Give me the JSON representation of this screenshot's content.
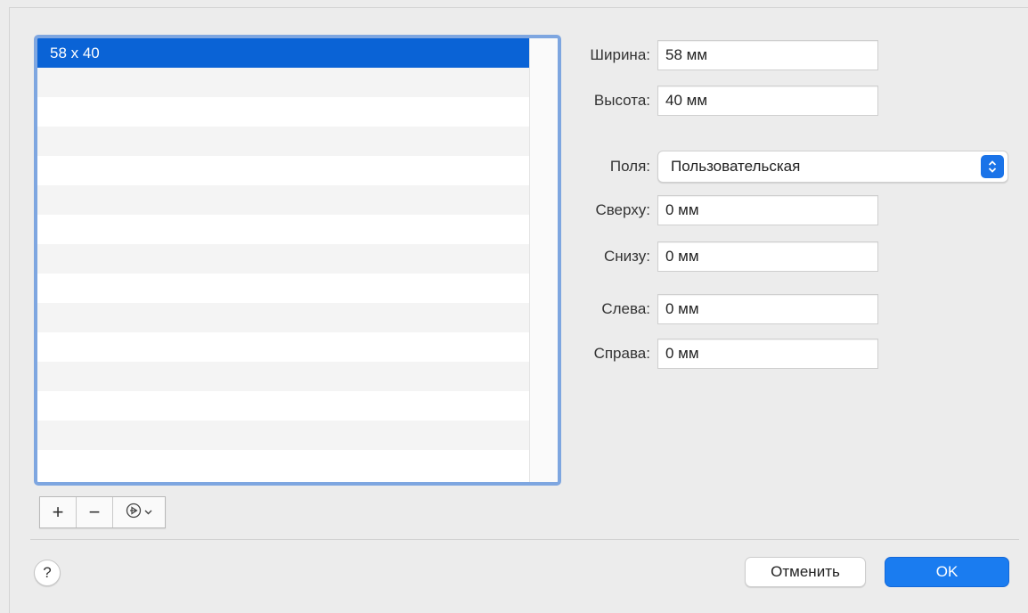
{
  "list": {
    "items": [
      "58 x 40"
    ],
    "empty_rows": 14
  },
  "toolbar": {
    "add_label": "+",
    "remove_label": "−",
    "action_icon": "action-menu-icon"
  },
  "form": {
    "width_label": "Ширина:",
    "width_value": "58 мм",
    "height_label": "Высота:",
    "height_value": "40 мм",
    "margins_label": "Поля:",
    "margins_selected": "Пользовательская",
    "top_label": "Сверху:",
    "top_value": "0 мм",
    "bottom_label": "Снизу:",
    "bottom_value": "0 мм",
    "left_label": "Слева:",
    "left_value": "0 мм",
    "right_label": "Справа:",
    "right_value": "0 мм"
  },
  "footer": {
    "help_label": "?",
    "cancel_label": "Отменить",
    "ok_label": "OK"
  },
  "colors": {
    "selection": "#0a63d6",
    "accent": "#1a7cf0",
    "focus_ring": "#7ea6e0"
  }
}
